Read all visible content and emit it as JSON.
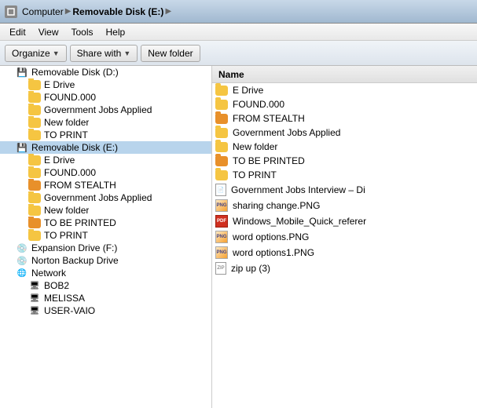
{
  "titlebar": {
    "breadcrumb": [
      "Computer",
      "Removable Disk (E:)"
    ]
  },
  "menubar": {
    "items": [
      "Edit",
      "View",
      "Tools",
      "Help"
    ]
  },
  "toolbar": {
    "organize_label": "Organize",
    "share_label": "Share with",
    "newfolder_label": "New folder"
  },
  "left_tree": {
    "items": [
      {
        "id": "removable-d",
        "label": "Removable Disk (D:)",
        "type": "drive",
        "indent": 1
      },
      {
        "id": "e-drive-d",
        "label": "E Drive",
        "type": "folder",
        "indent": 2
      },
      {
        "id": "found-d",
        "label": "FOUND.000",
        "type": "folder",
        "indent": 2
      },
      {
        "id": "gov-jobs-d",
        "label": "Government Jobs Applied",
        "type": "folder",
        "indent": 2
      },
      {
        "id": "new-folder-d",
        "label": "New folder",
        "type": "folder",
        "indent": 2
      },
      {
        "id": "to-print-d",
        "label": "TO PRINT",
        "type": "folder",
        "indent": 2
      },
      {
        "id": "removable-e",
        "label": "Removable Disk (E:)",
        "type": "drive",
        "indent": 1,
        "selected": true
      },
      {
        "id": "e-drive-e",
        "label": "E Drive",
        "type": "folder",
        "indent": 2
      },
      {
        "id": "found-e",
        "label": "FOUND.000",
        "type": "folder",
        "indent": 2
      },
      {
        "id": "from-stealth-e",
        "label": "FROM STEALTH",
        "type": "folder",
        "indent": 2
      },
      {
        "id": "gov-jobs-e",
        "label": "Government Jobs Applied",
        "type": "folder",
        "indent": 2
      },
      {
        "id": "new-folder-e",
        "label": "New folder",
        "type": "folder",
        "indent": 2
      },
      {
        "id": "to-be-printed-e",
        "label": "TO BE PRINTED",
        "type": "folder",
        "indent": 2
      },
      {
        "id": "to-print-e",
        "label": "TO PRINT",
        "type": "folder",
        "indent": 2
      },
      {
        "id": "expansion-f",
        "label": "Expansion Drive (F:)",
        "type": "drive",
        "indent": 1
      },
      {
        "id": "norton-backup",
        "label": "Norton Backup Drive",
        "type": "drive",
        "indent": 1
      },
      {
        "id": "network",
        "label": "Network",
        "type": "network",
        "indent": 1
      },
      {
        "id": "bob2",
        "label": "BOB2",
        "type": "network-pc",
        "indent": 2
      },
      {
        "id": "melissa",
        "label": "MELISSA",
        "type": "network-pc",
        "indent": 2
      },
      {
        "id": "user-vaio",
        "label": "USER-VAIO",
        "type": "network-pc",
        "indent": 2
      }
    ]
  },
  "right_panel": {
    "column_header": "Name",
    "files": [
      {
        "name": "E Drive",
        "type": "folder"
      },
      {
        "name": "FOUND.000",
        "type": "folder"
      },
      {
        "name": "FROM STEALTH",
        "type": "folder",
        "color": "orange"
      },
      {
        "name": "Government Jobs Applied",
        "type": "folder"
      },
      {
        "name": "New folder",
        "type": "folder"
      },
      {
        "name": "TO BE PRINTED",
        "type": "folder",
        "color": "orange"
      },
      {
        "name": "TO PRINT",
        "type": "folder"
      },
      {
        "name": "Government Jobs Interview – Di",
        "type": "doc"
      },
      {
        "name": "sharing change.PNG",
        "type": "png-orange"
      },
      {
        "name": "Windows_Mobile_Quick_referer",
        "type": "pdf"
      },
      {
        "name": "word options.PNG",
        "type": "png-orange"
      },
      {
        "name": "word options1.PNG",
        "type": "png-orange"
      },
      {
        "name": "zip up (3)",
        "type": "zip"
      }
    ]
  }
}
